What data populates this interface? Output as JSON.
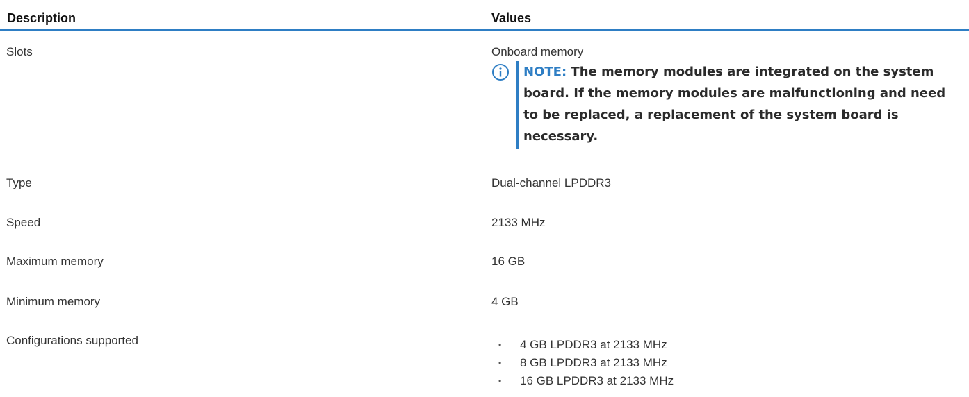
{
  "table": {
    "headers": {
      "description": "Description",
      "values": "Values"
    },
    "rows": [
      {
        "description": "Slots",
        "value": "Onboard memory"
      },
      {
        "description": "Type",
        "value": "Dual-channel LPDDR3"
      },
      {
        "description": "Speed",
        "value": "2133 MHz"
      },
      {
        "description": "Maximum memory",
        "value": "16 GB"
      },
      {
        "description": "Minimum memory",
        "value": "4 GB"
      },
      {
        "description": "Configurations supported",
        "items": [
          "4 GB LPDDR3 at 2133 MHz",
          "8 GB LPDDR3 at 2133 MHz",
          "16 GB LPDDR3 at 2133 MHz"
        ]
      }
    ],
    "note": {
      "label": "NOTE:",
      "text": "The memory modules are integrated on the system board. If the memory modules are malfunctioning and need to be replaced, a replacement of the system board is necessary.",
      "icon": "info-icon"
    },
    "bullet_glyph": "•"
  },
  "colors": {
    "accent": "#2e7ec4",
    "text": "#333333"
  }
}
